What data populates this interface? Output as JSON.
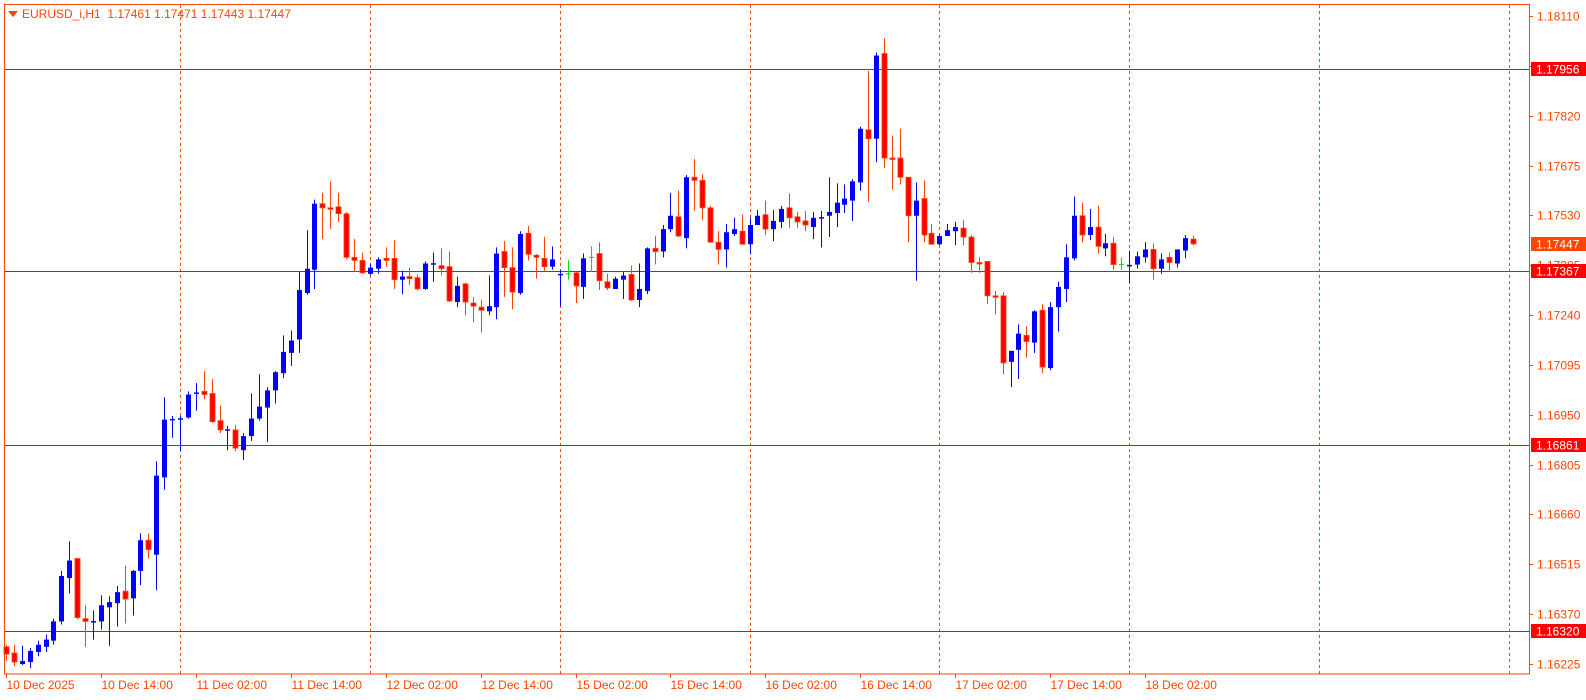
{
  "header": {
    "symbol": "EURUSD_i,H1",
    "ohlc_text": "1.17461 1.17471 1.17443 1.17447",
    "menu_icon": "triangle-down-icon"
  },
  "colors": {
    "bull": "#0000ff",
    "bear_fill": "#ff0000",
    "bear_line": "#ff4500",
    "doji": "#00e000",
    "axis": "#ff4500",
    "level_line": "#ff0000",
    "level_label_bg": "#ff0000",
    "current_label_bg": "#ff4500",
    "background": "#ffffff"
  },
  "chart_data": {
    "type": "candlestick",
    "symbol": "EURUSD_i",
    "timeframe": "H1",
    "ylim": [
      1.16196,
      1.18142
    ],
    "y_ticks": [
      "1.18110",
      "1.17965",
      "1.17820",
      "1.17675",
      "1.17530",
      "1.17385",
      "1.17240",
      "1.17095",
      "1.16950",
      "1.16805",
      "1.16660",
      "1.16515",
      "1.16370",
      "1.16225"
    ],
    "x_labels": [
      "10 Dec 2025",
      "10 Dec 14:00",
      "11 Dec 02:00",
      "11 Dec 14:00",
      "12 Dec 02:00",
      "12 Dec 14:00",
      "15 Dec 02:00",
      "15 Dec 14:00",
      "16 Dec 02:00",
      "16 Dec 14:00",
      "17 Dec 02:00",
      "17 Dec 14:00",
      "18 Dec 02:00"
    ],
    "day_separators": true,
    "horizontal_levels": [
      "1.17956",
      "1.17367",
      "1.16861",
      "1.16320"
    ],
    "current_price": "1.17447",
    "ohlc": [
      [
        1.16275,
        1.16281,
        1.16234,
        1.16254
      ],
      [
        1.16257,
        1.16281,
        1.16219,
        1.16231
      ],
      [
        1.16225,
        1.16278,
        1.16222,
        1.16234
      ],
      [
        1.16231,
        1.16272,
        1.16213,
        1.16263
      ],
      [
        1.1626,
        1.16293,
        1.16248,
        1.16281
      ],
      [
        1.16275,
        1.1631,
        1.1626,
        1.16296
      ],
      [
        1.16293,
        1.16357,
        1.16281,
        1.16349
      ],
      [
        1.16349,
        1.16496,
        1.1634,
        1.16481
      ],
      [
        1.16475,
        1.16582,
        1.16431,
        1.16526
      ],
      [
        1.16532,
        1.16532,
        1.16355,
        1.1636
      ],
      [
        1.16357,
        1.16396,
        1.16275,
        1.16349
      ],
      [
        1.16349,
        1.16381,
        1.16296,
        1.1635
      ],
      [
        1.16349,
        1.16425,
        1.16325,
        1.16396
      ],
      [
        1.1639,
        1.16422,
        1.16278,
        1.16405
      ],
      [
        1.16402,
        1.16452,
        1.16334,
        1.16434
      ],
      [
        1.16437,
        1.16511,
        1.16343,
        1.16414
      ],
      [
        1.16416,
        1.16499,
        1.16366,
        1.16496
      ],
      [
        1.16496,
        1.16605,
        1.16455,
        1.16585
      ],
      [
        1.16585,
        1.16605,
        1.16532,
        1.16558
      ],
      [
        1.16543,
        1.16815,
        1.1644,
        1.16773
      ],
      [
        1.16768,
        1.17001,
        1.16732,
        1.16936
      ],
      [
        1.16936,
        1.16947,
        1.16883,
        1.16938
      ],
      [
        1.16938,
        1.16947,
        1.16844,
        1.1694
      ],
      [
        1.16942,
        1.17018,
        1.16939,
        1.17009
      ],
      [
        1.17012,
        1.17042,
        1.16962,
        1.17015
      ],
      [
        1.17018,
        1.17077,
        1.16995,
        1.17009
      ],
      [
        1.17012,
        1.17054,
        1.16927,
        1.1693
      ],
      [
        1.16933,
        1.16977,
        1.16897,
        1.16906
      ],
      [
        1.16906,
        1.16918,
        1.16847,
        1.16908
      ],
      [
        1.16906,
        1.16921,
        1.16844,
        1.16853
      ],
      [
        1.16847,
        1.16897,
        1.16818,
        1.16888
      ],
      [
        1.16888,
        1.17012,
        1.16874,
        1.16939
      ],
      [
        1.16939,
        1.17068,
        1.16933,
        1.16974
      ],
      [
        1.16971,
        1.1703,
        1.16871,
        1.17021
      ],
      [
        1.17021,
        1.17077,
        1.16983,
        1.17074
      ],
      [
        1.17071,
        1.17181,
        1.17057,
        1.17133
      ],
      [
        1.1713,
        1.17195,
        1.17092,
        1.17166
      ],
      [
        1.17169,
        1.17366,
        1.1713,
        1.17313
      ],
      [
        1.17304,
        1.17487,
        1.17299,
        1.17375
      ],
      [
        1.17372,
        1.17576,
        1.17316,
        1.17564
      ],
      [
        1.17564,
        1.17596,
        1.17461,
        1.17552
      ],
      [
        1.17552,
        1.17629,
        1.1749,
        1.17549
      ],
      [
        1.17555,
        1.17596,
        1.17511,
        1.17535
      ],
      [
        1.17535,
        1.1754,
        1.17402,
        1.17408
      ],
      [
        1.17408,
        1.17461,
        1.17366,
        1.17399
      ],
      [
        1.17399,
        1.17422,
        1.1736,
        1.17363
      ],
      [
        1.1736,
        1.1739,
        1.17355,
        1.17378
      ],
      [
        1.17375,
        1.17408,
        1.1736,
        1.17402
      ],
      [
        1.17405,
        1.17437,
        1.17381,
        1.17399
      ],
      [
        1.17405,
        1.17458,
        1.17316,
        1.17343
      ],
      [
        1.17343,
        1.17369,
        1.17301,
        1.17352
      ],
      [
        1.17352,
        1.17378,
        1.17328,
        1.17346
      ],
      [
        1.17349,
        1.17358,
        1.17313,
        1.17316
      ],
      [
        1.17316,
        1.17396,
        1.17313,
        1.1739
      ],
      [
        1.1739,
        1.17422,
        1.17337,
        1.17391
      ],
      [
        1.17384,
        1.17434,
        1.17355,
        1.17375
      ],
      [
        1.17381,
        1.17425,
        1.17278,
        1.17281
      ],
      [
        1.17278,
        1.17352,
        1.17263,
        1.17325
      ],
      [
        1.17331,
        1.17334,
        1.1724,
        1.17278
      ],
      [
        1.17275,
        1.17293,
        1.17219,
        1.17266
      ],
      [
        1.17263,
        1.17284,
        1.17189,
        1.17254
      ],
      [
        1.17251,
        1.17355,
        1.1724,
        1.17266
      ],
      [
        1.17263,
        1.17437,
        1.17228,
        1.17419
      ],
      [
        1.17425,
        1.17455,
        1.17293,
        1.17378
      ],
      [
        1.17378,
        1.17437,
        1.17257,
        1.17307
      ],
      [
        1.17304,
        1.17484,
        1.17299,
        1.17476
      ],
      [
        1.17478,
        1.17499,
        1.17399,
        1.17417
      ],
      [
        1.17414,
        1.17417,
        1.17346,
        1.17408
      ],
      [
        1.17405,
        1.17467,
        1.17369,
        1.17381
      ],
      [
        1.17381,
        1.1744,
        1.17372,
        1.17402
      ],
      [
        1.17358,
        1.17372,
        1.17266,
        1.1736
      ],
      [
        1.1736,
        1.17399,
        1.17343,
        1.1736
      ],
      [
        1.17363,
        1.17366,
        1.17275,
        1.17325
      ],
      [
        1.17322,
        1.17419,
        1.17287,
        1.17405
      ],
      [
        1.17408,
        1.1744,
        1.17366,
        1.17408
      ],
      [
        1.17419,
        1.17452,
        1.17313,
        1.1734
      ],
      [
        1.17337,
        1.1736,
        1.17313,
        1.17319
      ],
      [
        1.17316,
        1.17352,
        1.17316,
        1.17346
      ],
      [
        1.17343,
        1.17366,
        1.17287,
        1.17355
      ],
      [
        1.17358,
        1.17384,
        1.17281,
        1.17284
      ],
      [
        1.17284,
        1.1739,
        1.17263,
        1.17316
      ],
      [
        1.1731,
        1.17437,
        1.17301,
        1.17434
      ],
      [
        1.17434,
        1.1747,
        1.17387,
        1.17425
      ],
      [
        1.17425,
        1.17502,
        1.17408,
        1.1749
      ],
      [
        1.1749,
        1.17596,
        1.17481,
        1.17529
      ],
      [
        1.17526,
        1.17602,
        1.17467,
        1.1747
      ],
      [
        1.17464,
        1.17647,
        1.17434,
        1.17641
      ],
      [
        1.17641,
        1.17694,
        1.17543,
        1.17632
      ],
      [
        1.17632,
        1.1765,
        1.17517,
        1.17552
      ],
      [
        1.17552,
        1.17558,
        1.17452,
        1.17452
      ],
      [
        1.17452,
        1.17484,
        1.17387,
        1.17431
      ],
      [
        1.17431,
        1.17505,
        1.17378,
        1.17481
      ],
      [
        1.17476,
        1.17523,
        1.1747,
        1.1749
      ],
      [
        1.17484,
        1.17532,
        1.17446,
        1.17446
      ],
      [
        1.17446,
        1.17523,
        1.17417,
        1.17502
      ],
      [
        1.17502,
        1.17546,
        1.17502,
        1.17529
      ],
      [
        1.17532,
        1.17573,
        1.17473,
        1.1749
      ],
      [
        1.1749,
        1.17546,
        1.17455,
        1.17514
      ],
      [
        1.17511,
        1.17558,
        1.17493,
        1.17549
      ],
      [
        1.17552,
        1.17594,
        1.17493,
        1.17523
      ],
      [
        1.17526,
        1.1754,
        1.17493,
        1.17511
      ],
      [
        1.17514,
        1.17543,
        1.17484,
        1.17502
      ],
      [
        1.17496,
        1.1754,
        1.17461,
        1.17523
      ],
      [
        1.17523,
        1.17543,
        1.17437,
        1.17525
      ],
      [
        1.17529,
        1.17641,
        1.17467,
        1.1754
      ],
      [
        1.17537,
        1.17623,
        1.17496,
        1.17567
      ],
      [
        1.17561,
        1.1762,
        1.17537,
        1.17579
      ],
      [
        1.17573,
        1.17635,
        1.17514,
        1.17629
      ],
      [
        1.17626,
        1.17788,
        1.17602,
        1.17782
      ],
      [
        1.17779,
        1.1795,
        1.1757,
        1.17753
      ],
      [
        1.17753,
        1.18004,
        1.17685,
        1.17995
      ],
      [
        1.18001,
        1.18045,
        1.17667,
        1.17697
      ],
      [
        1.17697,
        1.17762,
        1.17605,
        1.17694
      ],
      [
        1.17697,
        1.17782,
        1.1762,
        1.17641
      ],
      [
        1.17641,
        1.17641,
        1.17452,
        1.17529
      ],
      [
        1.17529,
        1.17626,
        1.1734,
        1.17573
      ],
      [
        1.17579,
        1.17632,
        1.17452,
        1.17473
      ],
      [
        1.17478,
        1.17505,
        1.17446,
        1.17446
      ],
      [
        1.17446,
        1.17476,
        1.17443,
        1.1747
      ],
      [
        1.1747,
        1.17505,
        1.1747,
        1.17487
      ],
      [
        1.17484,
        1.17511,
        1.17443,
        1.17496
      ],
      [
        1.17493,
        1.17517,
        1.17443,
        1.17467
      ],
      [
        1.17467,
        1.17473,
        1.17363,
        1.17393
      ],
      [
        1.17393,
        1.17408,
        1.17363,
        1.1739
      ],
      [
        1.17396,
        1.17396,
        1.17272,
        1.17296
      ],
      [
        1.17296,
        1.1731,
        1.17242,
        1.17293
      ],
      [
        1.17296,
        1.17307,
        1.17068,
        1.17101
      ],
      [
        1.17104,
        1.17136,
        1.1703,
        1.17136
      ],
      [
        1.17139,
        1.17213,
        1.17054,
        1.17186
      ],
      [
        1.17181,
        1.17207,
        1.17116,
        1.17163
      ],
      [
        1.1716,
        1.17254,
        1.1713,
        1.17251
      ],
      [
        1.17254,
        1.17272,
        1.17071,
        1.17089
      ],
      [
        1.17086,
        1.17278,
        1.1708,
        1.17263
      ],
      [
        1.17263,
        1.17337,
        1.17192,
        1.17322
      ],
      [
        1.17316,
        1.17446,
        1.17278,
        1.17408
      ],
      [
        1.17405,
        1.17585,
        1.17399,
        1.17529
      ],
      [
        1.17529,
        1.17567,
        1.17452,
        1.17473
      ],
      [
        1.17473,
        1.17549,
        1.17458,
        1.17496
      ],
      [
        1.17496,
        1.17558,
        1.17419,
        1.1744
      ],
      [
        1.17434,
        1.17476,
        1.17411,
        1.17449
      ],
      [
        1.17449,
        1.17467,
        1.17372,
        1.17387
      ],
      [
        1.17387,
        1.17408,
        1.17372,
        1.17387
      ],
      [
        1.17384,
        1.17428,
        1.17334,
        1.17386
      ],
      [
        1.17387,
        1.17425,
        1.17375,
        1.17411
      ],
      [
        1.17408,
        1.17452,
        1.17393,
        1.17431
      ],
      [
        1.17431,
        1.17449,
        1.17343,
        1.17375
      ],
      [
        1.17375,
        1.17419,
        1.1736,
        1.17402
      ],
      [
        1.17408,
        1.17422,
        1.17369,
        1.17393
      ],
      [
        1.1739,
        1.17431,
        1.17378,
        1.17431
      ],
      [
        1.17428,
        1.17473,
        1.17405,
        1.17464
      ],
      [
        1.17461,
        1.17471,
        1.17443,
        1.17447
      ]
    ]
  }
}
